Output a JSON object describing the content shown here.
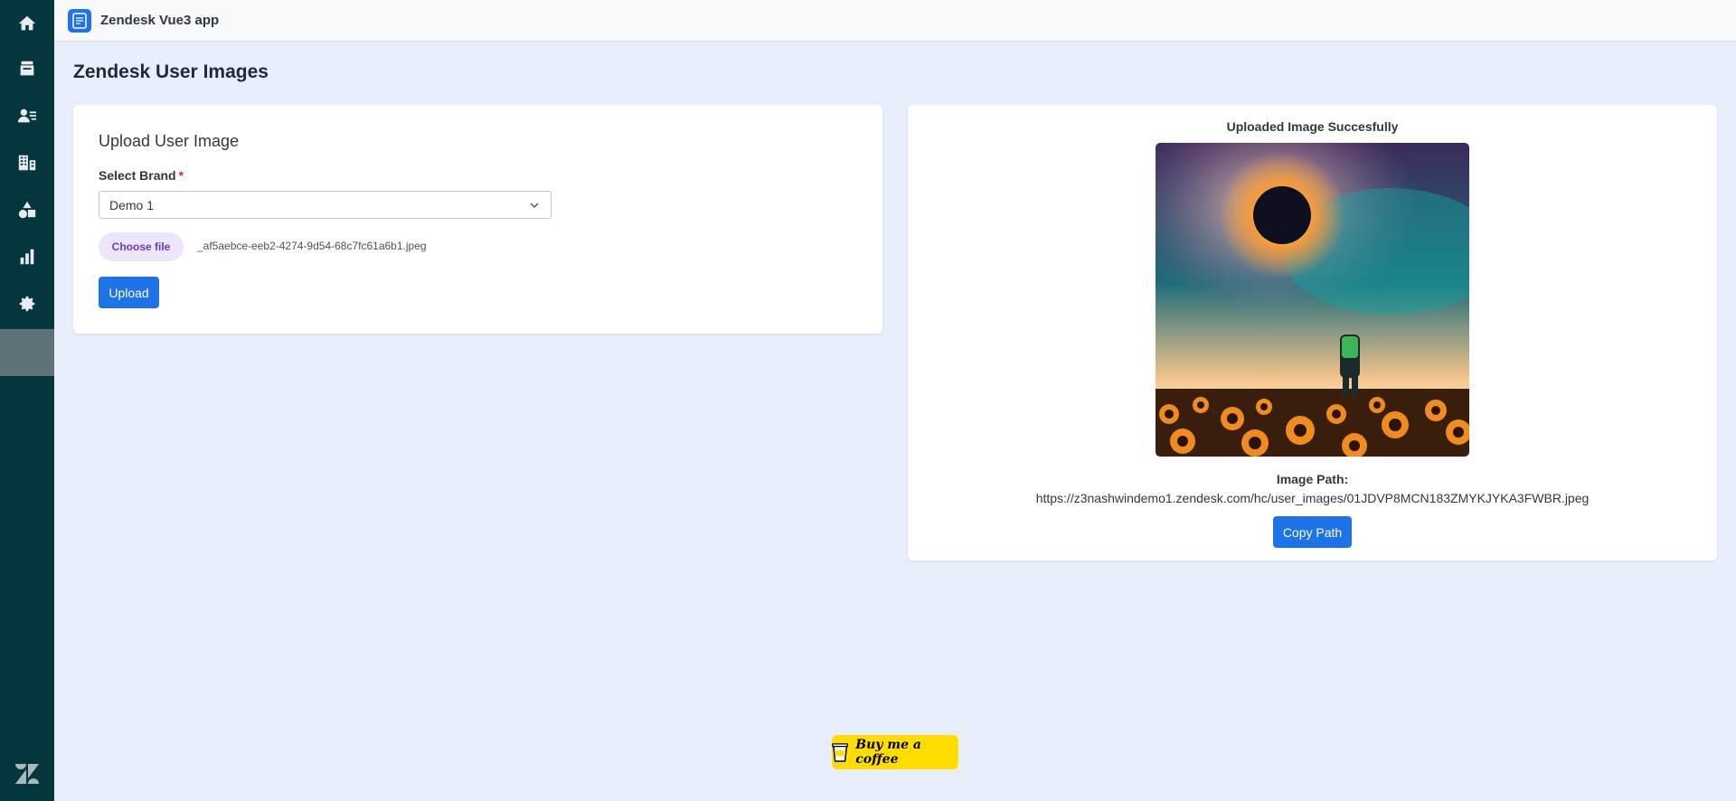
{
  "app": {
    "title": "Zendesk Vue3 app"
  },
  "sidebar": {
    "items": [
      {
        "icon": "home-icon"
      },
      {
        "icon": "views-icon"
      },
      {
        "icon": "customers-icon"
      },
      {
        "icon": "organizations-icon"
      },
      {
        "icon": "objects-icon"
      },
      {
        "icon": "reporting-icon"
      },
      {
        "icon": "admin-icon"
      },
      {
        "icon": "active-app-icon",
        "active": true
      }
    ],
    "logo_icon": "zendesk-logo-icon"
  },
  "page": {
    "title": "Zendesk User Images"
  },
  "upload_form": {
    "title": "Upload User Image",
    "brand_label": "Select Brand",
    "required_mark": "*",
    "brand_value": "Demo 1",
    "choose_file_label": "Choose file",
    "file_name": "_af5aebce-eeb2-4274-9d54-68c7fc61a6b1.jpeg",
    "upload_label": "Upload"
  },
  "result": {
    "title": "Uploaded Image Succesfully",
    "path_label": "Image Path:",
    "path_value": "https://z3nashwindemo1.zendesk.com/hc/user_images/01JDVP8MCN183ZMYKJYKA3FWBR.jpeg",
    "copy_label": "Copy Path"
  },
  "footer": {
    "coffee_label": "Buy me a coffee"
  },
  "colors": {
    "accent": "#1f73e8",
    "sidebar": "#03363d",
    "background": "#e8eefb"
  }
}
